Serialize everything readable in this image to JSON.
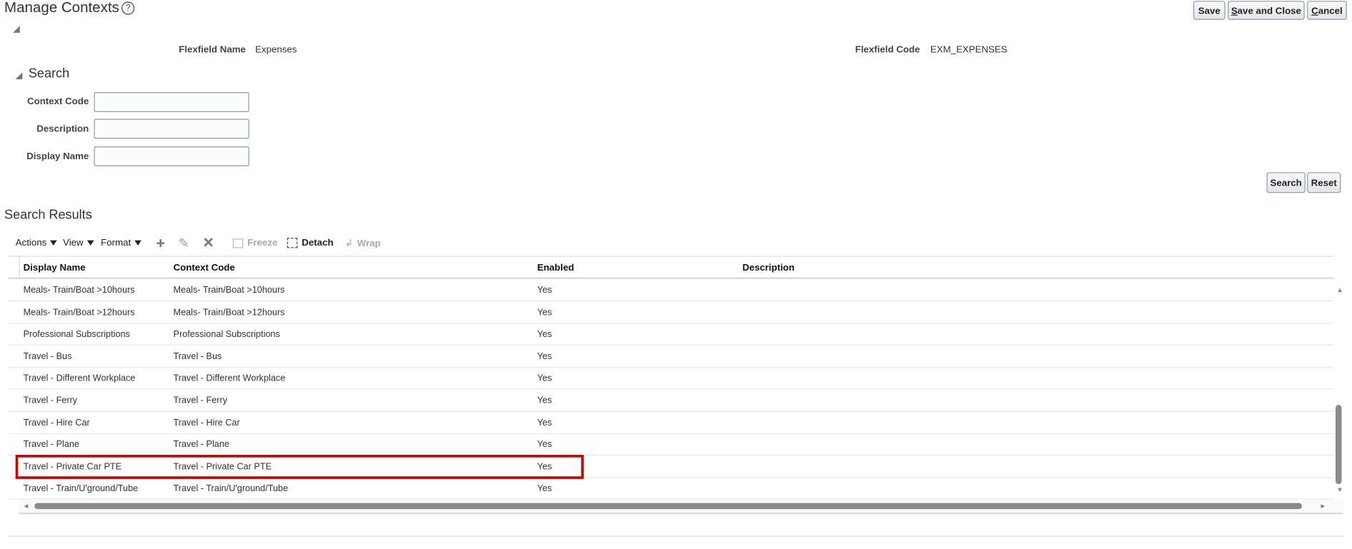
{
  "header": {
    "title": "Manage Contexts",
    "help_icon": "?",
    "buttons": {
      "save": "Save",
      "save_close_u": "S",
      "save_close_rest": "ave and Close",
      "cancel_u": "C",
      "cancel_rest": "ancel"
    }
  },
  "flexfield": {
    "name_label": "Flexfield Name",
    "name_value": "Expenses",
    "code_label": "Flexfield Code",
    "code_value": "EXM_EXPENSES"
  },
  "search": {
    "title": "Search",
    "fields": [
      {
        "label": "Context Code",
        "value": ""
      },
      {
        "label": "Description",
        "value": ""
      },
      {
        "label": "Display Name",
        "value": ""
      }
    ],
    "search_button": "Search",
    "reset_button": "Reset"
  },
  "results": {
    "title": "Search Results",
    "toolbar": {
      "actions": "Actions",
      "view": "View",
      "format": "Format",
      "freeze": "Freeze",
      "detach": "Detach",
      "wrap": "Wrap"
    },
    "columns": [
      "Display Name",
      "Context Code",
      "Enabled",
      "Description"
    ],
    "rows": [
      [
        "Meals- Train/Boat >10hours",
        "Meals- Train/Boat >10hours",
        "Yes",
        ""
      ],
      [
        "Meals- Train/Boat >12hours",
        "Meals- Train/Boat >12hours",
        "Yes",
        ""
      ],
      [
        "Professional Subscriptions",
        "Professional Subscriptions",
        "Yes",
        ""
      ],
      [
        "Travel - Bus",
        "Travel - Bus",
        "Yes",
        ""
      ],
      [
        "Travel - Different Workplace",
        "Travel - Different Workplace",
        "Yes",
        ""
      ],
      [
        "Travel - Ferry",
        "Travel - Ferry",
        "Yes",
        ""
      ],
      [
        "Travel - Hire Car",
        "Travel - Hire Car",
        "Yes",
        ""
      ],
      [
        "Travel - Plane",
        "Travel - Plane",
        "Yes",
        ""
      ],
      [
        "Travel - Private Car PTE",
        "Travel - Private Car PTE",
        "Yes",
        ""
      ],
      [
        "Travel - Train/U'ground/Tube",
        "Travel - Train/U'ground/Tube",
        "Yes",
        ""
      ]
    ],
    "highlighted_row": 8,
    "highlight_color": "#cc0000"
  }
}
